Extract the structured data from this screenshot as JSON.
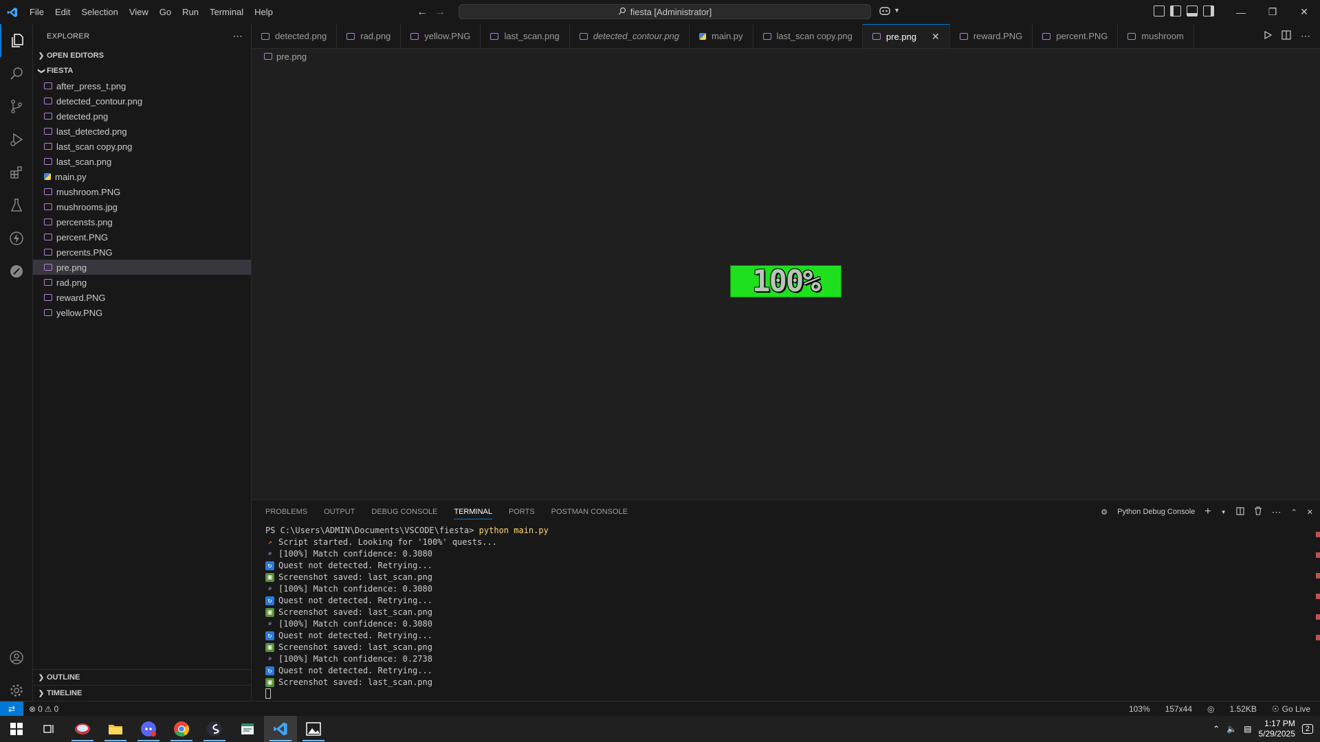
{
  "menu": [
    "File",
    "Edit",
    "Selection",
    "View",
    "Go",
    "Run",
    "Terminal",
    "Help"
  ],
  "command_center": "fiesta [Administrator]",
  "sidebar": {
    "title": "EXPLORER",
    "open_editors": "OPEN EDITORS",
    "folder": "FIESTA",
    "files": [
      {
        "name": "after_press_t.png",
        "type": "image"
      },
      {
        "name": "detected_contour.png",
        "type": "image"
      },
      {
        "name": "detected.png",
        "type": "image"
      },
      {
        "name": "last_detected.png",
        "type": "image"
      },
      {
        "name": "last_scan copy.png",
        "type": "image"
      },
      {
        "name": "last_scan.png",
        "type": "image"
      },
      {
        "name": "main.py",
        "type": "python"
      },
      {
        "name": "mushroom.PNG",
        "type": "image"
      },
      {
        "name": "mushrooms.jpg",
        "type": "image"
      },
      {
        "name": "percensts.png",
        "type": "image"
      },
      {
        "name": "percent.PNG",
        "type": "image"
      },
      {
        "name": "percents.PNG",
        "type": "image"
      },
      {
        "name": "pre.png",
        "type": "image",
        "selected": true
      },
      {
        "name": "rad.png",
        "type": "image"
      },
      {
        "name": "reward.PNG",
        "type": "image"
      },
      {
        "name": "yellow.PNG",
        "type": "image"
      }
    ],
    "outline": "OUTLINE",
    "timeline": "TIMELINE"
  },
  "tabs": [
    {
      "label": "detected.png",
      "type": "image"
    },
    {
      "label": "rad.png",
      "type": "image"
    },
    {
      "label": "yellow.PNG",
      "type": "image"
    },
    {
      "label": "last_scan.png",
      "type": "image"
    },
    {
      "label": "detected_contour.png",
      "type": "image",
      "italic": true
    },
    {
      "label": "main.py",
      "type": "python"
    },
    {
      "label": "last_scan copy.png",
      "type": "image"
    },
    {
      "label": "pre.png",
      "type": "image",
      "active": true
    },
    {
      "label": "reward.PNG",
      "type": "image"
    },
    {
      "label": "percent.PNG",
      "type": "image"
    },
    {
      "label": "mushroom",
      "type": "image"
    }
  ],
  "breadcrumb": "pre.png",
  "preview_text": "100%",
  "panel": {
    "tabs": [
      "PROBLEMS",
      "OUTPUT",
      "DEBUG CONSOLE",
      "TERMINAL",
      "PORTS",
      "POSTMAN CONSOLE"
    ],
    "active_tab": "TERMINAL",
    "shell_label": "Python Debug Console"
  },
  "terminal": {
    "prompt": "PS C:\\Users\\ADMIN\\Documents\\VSCODE\\fiesta> ",
    "command": "python main.py",
    "lines": [
      {
        "icon": "rocket",
        "text": "Script started. Looking for '100%' quests..."
      },
      {
        "icon": "search",
        "text": "[100%] Match confidence: 0.3080"
      },
      {
        "icon": "retry",
        "text": "Quest not detected. Retrying..."
      },
      {
        "icon": "shot",
        "text": "Screenshot saved: last_scan.png"
      },
      {
        "icon": "search",
        "text": "[100%] Match confidence: 0.3080"
      },
      {
        "icon": "retry",
        "text": "Quest not detected. Retrying..."
      },
      {
        "icon": "shot",
        "text": "Screenshot saved: last_scan.png"
      },
      {
        "icon": "search",
        "text": "[100%] Match confidence: 0.3080"
      },
      {
        "icon": "retry",
        "text": "Quest not detected. Retrying..."
      },
      {
        "icon": "shot",
        "text": "Screenshot saved: last_scan.png"
      },
      {
        "icon": "search",
        "text": "[100%] Match confidence: 0.2738"
      },
      {
        "icon": "retry",
        "text": "Quest not detected. Retrying..."
      },
      {
        "icon": "shot",
        "text": "Screenshot saved: last_scan.png"
      }
    ]
  },
  "status": {
    "errors": "0",
    "warnings": "0",
    "zoom": "103%",
    "dimensions": "157x44",
    "size": "1.52KB",
    "golive": "Go Live"
  },
  "clock": {
    "time": "1:17 PM",
    "date": "5/29/2025"
  },
  "notifications": "2",
  "colors": {
    "accent": "#0078d4",
    "preview_bg": "#1fe01f"
  }
}
